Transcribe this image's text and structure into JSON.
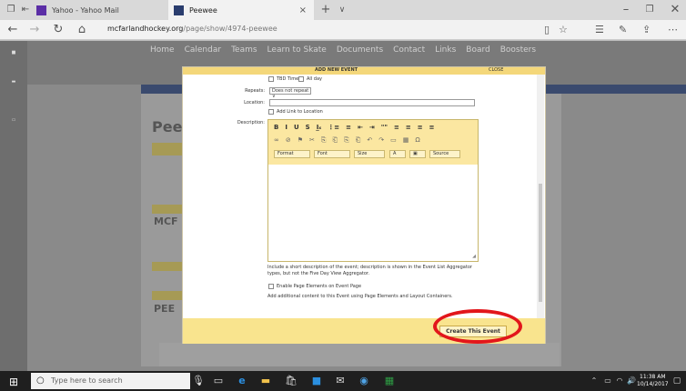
{
  "browser": {
    "tabs": [
      {
        "label": "Yahoo - Yahoo Mail"
      },
      {
        "label": "Peewee"
      }
    ],
    "url_host": "mcfarlandhockey.org",
    "url_path": "/page/show/4974-peewee"
  },
  "site": {
    "nav": [
      "Home",
      "Calendar",
      "Teams",
      "Learn to Skate",
      "Documents",
      "Contact",
      "Links",
      "Board",
      "Boosters"
    ],
    "page_title_fragment": "Pee",
    "ghost_heading_1": "MCF",
    "ghost_heading_2": "PEE"
  },
  "modal": {
    "title": "ADD NEW EVENT",
    "close_label": "CLOSE",
    "tbd_time_label": "TBD Time",
    "all_day_label": "All day",
    "repeats_label": "Repeats:",
    "repeats_value": "Does not repeat",
    "location_label": "Location:",
    "add_link_label": "Add Link to Location",
    "description_label": "Description:",
    "toolbar_row1": [
      "B",
      "I",
      "U",
      "S",
      "I̲ₓ",
      "⋮≡",
      "≡",
      "⇤",
      "⇥",
      "\"\"",
      "≡",
      "≡",
      "≡",
      "≡"
    ],
    "toolbar_row2": [
      "∞",
      "⊘",
      "⚑",
      "✂",
      "⎘",
      "⎗",
      "⎘",
      "⎗",
      "↶",
      "↷",
      "▭",
      "▦",
      "Ω"
    ],
    "format_label": "Format",
    "font_label": "Font",
    "size_label": "Size",
    "source_label": "Source",
    "help_text": "Include a short description of the event; description is shown in the Event List Aggregator types, but not the Five Day View Aggregator.",
    "page_elements_label": "Enable Page Elements on Event Page",
    "page_elements_help": "Add additional content to this Event using Page Elements and Layout Containers.",
    "create_button": "Create This Event"
  },
  "taskbar": {
    "search_placeholder": "Type here to search",
    "time": "11:38 AM",
    "date": "10/14/2017"
  }
}
